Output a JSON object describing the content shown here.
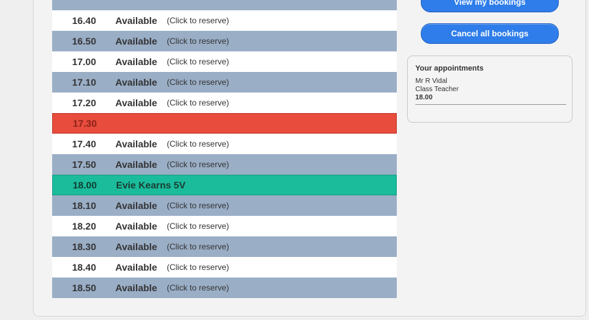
{
  "buttons": {
    "top_label": "View my bookings",
    "cancel_label": "Cancel all bookings"
  },
  "appointments": {
    "title": "Your appointments",
    "teacher": "Mr R Vidal",
    "role": "Class Teacher",
    "time": "18.00"
  },
  "slots": [
    {
      "time": "16.40",
      "status": "Available",
      "hint": "(Click to reserve)",
      "kind": "white"
    },
    {
      "time": "16.50",
      "status": "Available",
      "hint": "(Click to reserve)",
      "kind": "blue"
    },
    {
      "time": "17.00",
      "status": "Available",
      "hint": "(Click to reserve)",
      "kind": "white"
    },
    {
      "time": "17.10",
      "status": "Available",
      "hint": "(Click to reserve)",
      "kind": "blue"
    },
    {
      "time": "17.20",
      "status": "Available",
      "hint": "(Click to reserve)",
      "kind": "white"
    },
    {
      "time": "17.30",
      "status": "",
      "hint": "",
      "kind": "red"
    },
    {
      "time": "17.40",
      "status": "Available",
      "hint": "(Click to reserve)",
      "kind": "white"
    },
    {
      "time": "17.50",
      "status": "Available",
      "hint": "(Click to reserve)",
      "kind": "blue"
    },
    {
      "time": "18.00",
      "status": "Evie Kearns 5V",
      "hint": "",
      "kind": "green"
    },
    {
      "time": "18.10",
      "status": "Available",
      "hint": "(Click to reserve)",
      "kind": "blue"
    },
    {
      "time": "18.20",
      "status": "Available",
      "hint": "(Click to reserve)",
      "kind": "white"
    },
    {
      "time": "18.30",
      "status": "Available",
      "hint": "(Click to reserve)",
      "kind": "blue"
    },
    {
      "time": "18.40",
      "status": "Available",
      "hint": "(Click to reserve)",
      "kind": "white"
    },
    {
      "time": "18.50",
      "status": "Available",
      "hint": "(Click to reserve)",
      "kind": "blue"
    }
  ]
}
